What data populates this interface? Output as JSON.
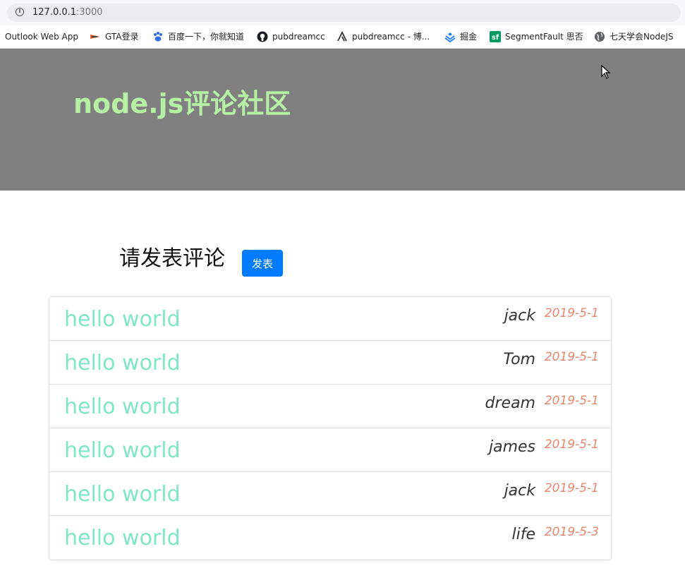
{
  "browser": {
    "url_host": "127.0.0.1",
    "url_port": ":3000",
    "bookmarks": [
      {
        "label": "Outlook Web App",
        "icon": "none"
      },
      {
        "label": "GTA登录",
        "icon": "gta-icon"
      },
      {
        "label": "百度一下，你就知道",
        "icon": "baidu-paw-icon"
      },
      {
        "label": "pubdreamcc",
        "icon": "github-icon"
      },
      {
        "label": "pubdreamcc - 博...",
        "icon": "cnblogs-icon"
      },
      {
        "label": "掘金",
        "icon": "juejin-icon"
      },
      {
        "label": "SegmentFault 思否",
        "icon": "segmentfault-icon"
      },
      {
        "label": "七天学会NodeJS",
        "icon": "globe-icon"
      }
    ]
  },
  "header": {
    "title": "node.js评论社区"
  },
  "prompt": {
    "text": "请发表评论",
    "button_label": "发表"
  },
  "comments": [
    {
      "content": "hello world",
      "author": "jack",
      "date": "2019-5-1"
    },
    {
      "content": "hello world",
      "author": "Tom",
      "date": "2019-5-1"
    },
    {
      "content": "hello world",
      "author": "dream",
      "date": "2019-5-1"
    },
    {
      "content": "hello world",
      "author": "james",
      "date": "2019-5-1"
    },
    {
      "content": "hello world",
      "author": "jack",
      "date": "2019-5-1"
    },
    {
      "content": "hello world",
      "author": "life",
      "date": "2019-5-3"
    }
  ],
  "colors": {
    "jumbotron": "#808080",
    "title": "#b5f0a4",
    "button": "#007bff",
    "comment_text": "#7fe6c6",
    "date": "#e8866c"
  }
}
